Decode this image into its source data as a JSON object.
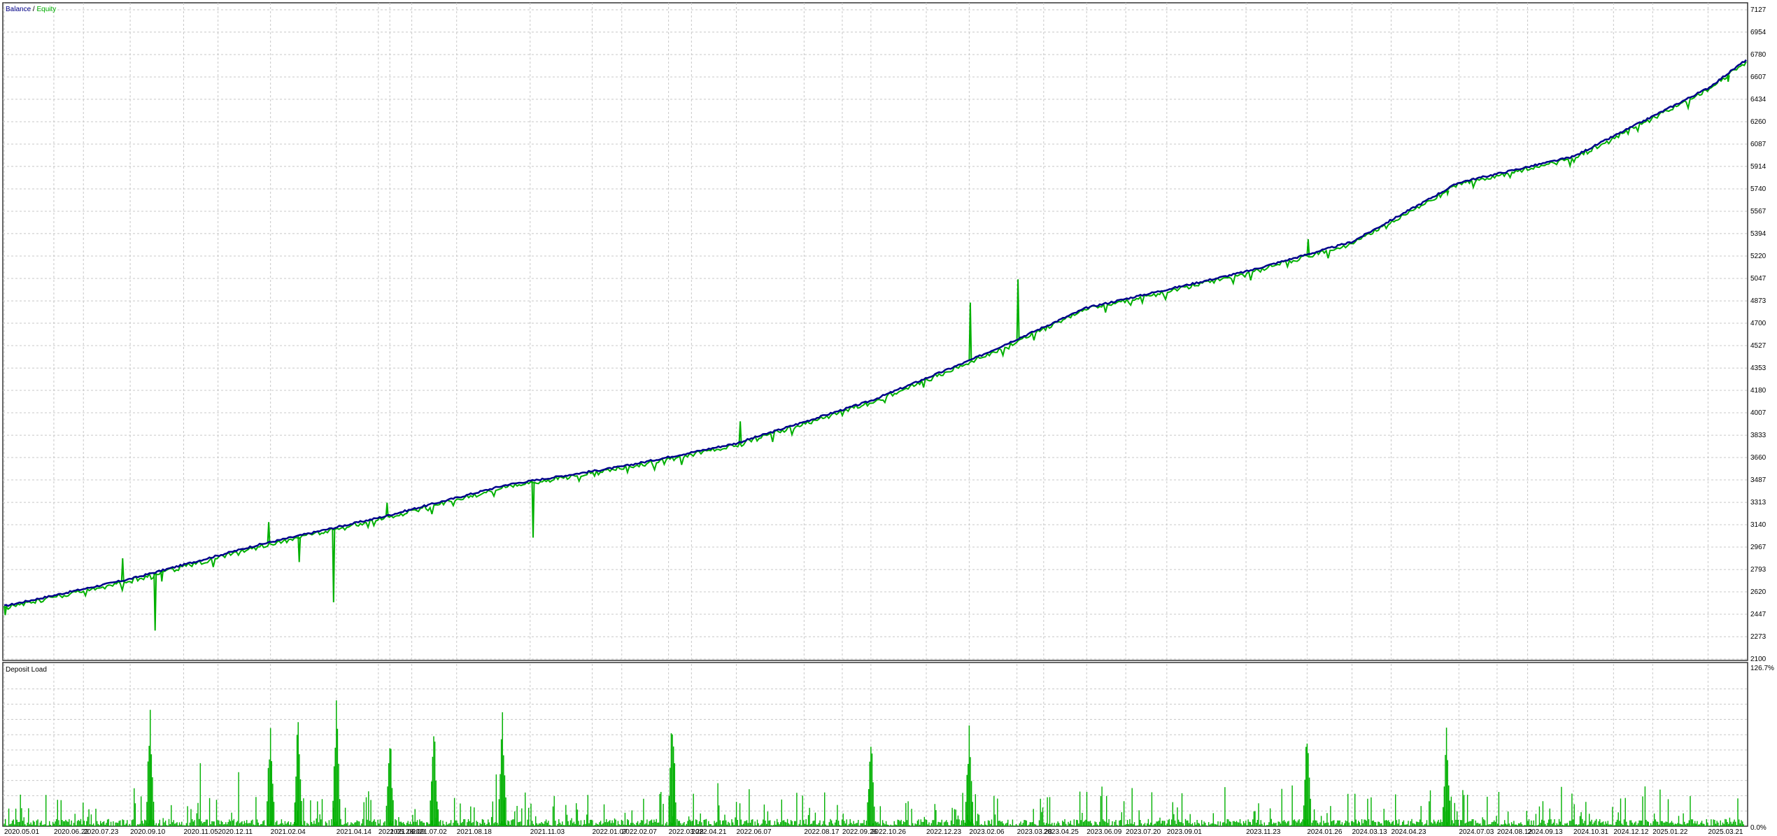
{
  "legend": {
    "balance_label": "Balance",
    "separator": " / ",
    "equity_label": "Equity"
  },
  "colors": {
    "balance": "#00008b",
    "equity": "#00b000",
    "deposit_load": "#00b000",
    "grid": "#c8c8c8",
    "frame": "#333333",
    "background": "#ffffff"
  },
  "chart_data": [
    {
      "type": "line",
      "title": "",
      "legend_placement": "top-left",
      "grid": true,
      "series": [
        {
          "name": "Balance",
          "color": "#00008b"
        },
        {
          "name": "Equity",
          "color": "#00b000"
        }
      ],
      "x": [
        "2020.05.01",
        "2020.09.10",
        "2021.01.20",
        "2021.06.01",
        "2021.10.10",
        "2022.02.07",
        "2022.06.07",
        "2022.10.26",
        "2023.02.06",
        "2023.06.09",
        "2023.11.23",
        "2024.03.13",
        "2024.07.03",
        "2024.10.31",
        "2025.03.21",
        "2025.04.30"
      ],
      "balance": [
        2510,
        2720,
        2980,
        3200,
        3450,
        3590,
        3770,
        4100,
        4410,
        4820,
        5100,
        5330,
        5790,
        5990,
        6520,
        6740
      ],
      "equity_dips": [
        {
          "date": "2020.05.01",
          "value": 2440
        },
        {
          "date": "2020.09.01",
          "value": 2880
        },
        {
          "date": "2020.10.05",
          "value": 2320
        },
        {
          "date": "2020.10.12",
          "value": 2700
        },
        {
          "date": "2021.02.01",
          "value": 3160
        },
        {
          "date": "2021.03.05",
          "value": 2850
        },
        {
          "date": "2021.04.10",
          "value": 2540
        },
        {
          "date": "2021.06.05",
          "value": 3310
        },
        {
          "date": "2021.11.05",
          "value": 3040
        },
        {
          "date": "2022.06.10",
          "value": 3940
        },
        {
          "date": "2022.10.20",
          "value": 4080
        },
        {
          "date": "2023.02.06",
          "value": 4860
        },
        {
          "date": "2023.03.28",
          "value": 5040
        },
        {
          "date": "2024.01.26",
          "value": 5350
        },
        {
          "date": "2024.06.20",
          "value": 5700
        },
        {
          "date": "2025.04.10",
          "value": 6570
        }
      ],
      "yticks": [
        "7127",
        "6954",
        "6780",
        "6607",
        "6434",
        "6260",
        "6087",
        "5914",
        "5740",
        "5567",
        "5394",
        "5220",
        "5047",
        "4873",
        "4700",
        "4527",
        "4353",
        "4180",
        "4007",
        "3833",
        "3660",
        "3487",
        "3313",
        "3140",
        "2967",
        "2793",
        "2620",
        "2447",
        "2273",
        "2100"
      ],
      "ylim": [
        2100,
        7127
      ]
    },
    {
      "type": "bar",
      "title": "Deposit Load",
      "grid": true,
      "series": [
        {
          "name": "",
          "color": "#00b000"
        }
      ],
      "ylim": [
        0.0,
        126.7
      ],
      "yticks": [
        "126.7%",
        "0.0%"
      ],
      "spikes": [
        {
          "date": "2020.10.01",
          "value": 110
        },
        {
          "date": "2021.02.04",
          "value": 100
        },
        {
          "date": "2021.03.05",
          "value": 108
        },
        {
          "date": "2021.04.14",
          "value": 112
        },
        {
          "date": "2021.06.09",
          "value": 88
        },
        {
          "date": "2021.07.25",
          "value": 104
        },
        {
          "date": "2021.10.05",
          "value": 112
        },
        {
          "date": "2022.04.01",
          "value": 108
        },
        {
          "date": "2022.10.26",
          "value": 85
        },
        {
          "date": "2023.02.06",
          "value": 94
        },
        {
          "date": "2024.01.26",
          "value": 98
        },
        {
          "date": "2024.06.20",
          "value": 86
        }
      ]
    }
  ],
  "xaxis_labels": [
    "2020.05.01",
    "2020.06.22",
    "2020.07.23",
    "2020.09.10",
    "2020.11.05",
    "2020.12.11",
    "2021.02.04",
    "2021.04.14",
    "2021.05.28",
    "2021.06.09",
    "2021.07.02",
    "2021.08.18",
    "2021.11.03",
    "2022.01.07",
    "2022.02.07",
    "2022.03.28",
    "2022.04.21",
    "2022.06.07",
    "2022.08.17",
    "2022.09.26",
    "2022.10.26",
    "2022.12.23",
    "2023.02.06",
    "2023.03.28",
    "2023.04.25",
    "2023.06.09",
    "2023.07.20",
    "2023.09.01",
    "2023.11.23",
    "2024.01.26",
    "2024.03.13",
    "2024.04.23",
    "2024.07.03",
    "2024.08.12",
    "2024.09.13",
    "2024.10.31",
    "2024.12.12",
    "2025.01.22",
    "2025.03.21"
  ]
}
